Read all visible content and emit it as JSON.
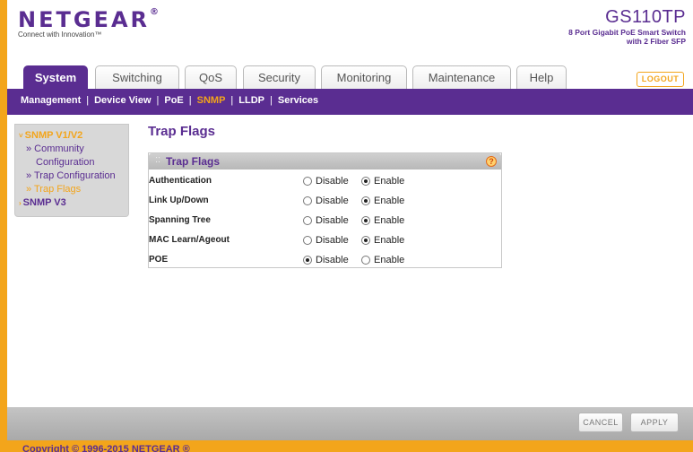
{
  "brand": {
    "logo": "NETGEAR",
    "registered_mark": "®",
    "tagline": "Connect with Innovation™"
  },
  "model": {
    "name": "GS110TP",
    "desc_line1": "8 Port Gigabit PoE Smart Switch",
    "desc_line2": "with 2 Fiber SFP"
  },
  "tabs": [
    {
      "label": "System",
      "active": true
    },
    {
      "label": "Switching",
      "active": false
    },
    {
      "label": "QoS",
      "active": false
    },
    {
      "label": "Security",
      "active": false
    },
    {
      "label": "Monitoring",
      "active": false
    },
    {
      "label": "Maintenance",
      "active": false
    },
    {
      "label": "Help",
      "active": false
    }
  ],
  "logout_label": "LOGOUT",
  "subnav": [
    {
      "label": "Management"
    },
    {
      "label": "Device View"
    },
    {
      "label": "PoE"
    },
    {
      "label": "SNMP",
      "current": true
    },
    {
      "label": "LLDP"
    },
    {
      "label": "Services"
    }
  ],
  "leftmenu": {
    "group1": {
      "icon": "˅",
      "label": "SNMP V1/V2"
    },
    "items": [
      {
        "label_line1": "» Community",
        "label_line2": "Configuration"
      },
      {
        "label": "» Trap Configuration"
      },
      {
        "label": "» Trap Flags"
      }
    ],
    "group2": {
      "icon": "›",
      "label": "SNMP V3"
    }
  },
  "page_title": "Trap Flags",
  "panel": {
    "title": "Trap Flags",
    "help": "?",
    "grip": "::",
    "rows": [
      {
        "label": "Authentication",
        "disable": "Disable",
        "enable": "Enable",
        "value": "enable"
      },
      {
        "label": "Link Up/Down",
        "disable": "Disable",
        "enable": "Enable",
        "value": "enable"
      },
      {
        "label": "Spanning Tree",
        "disable": "Disable",
        "enable": "Enable",
        "value": "enable"
      },
      {
        "label": "MAC Learn/Ageout",
        "disable": "Disable",
        "enable": "Enable",
        "value": "enable"
      },
      {
        "label": "POE",
        "disable": "Disable",
        "enable": "Enable",
        "value": "disable"
      }
    ]
  },
  "buttons": {
    "cancel": "CANCEL",
    "apply": "APPLY"
  },
  "copyright": "Copyright © 1996-2015 NETGEAR ®",
  "colors": {
    "brand_purple": "#5a2d91",
    "accent_orange": "#f3a51b"
  }
}
